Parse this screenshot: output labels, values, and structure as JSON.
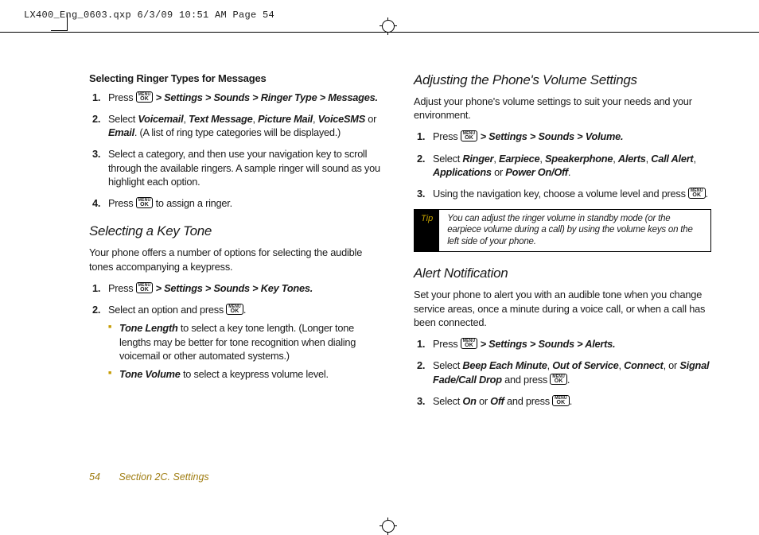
{
  "header_line": "LX400_Eng_0603.qxp  6/3/09  10:51 AM  Page 54",
  "ok_top": "MENU",
  "ok_bottom": "OK",
  "left": {
    "h3": "Selecting Ringer Types for Messages",
    "steps_msg": {
      "s1a": "Press ",
      "s1b": " > Settings > Sounds > Ringer Type > Messages.",
      "s2a": "Select ",
      "s2b": "Voicemail",
      "s2c": ", ",
      "s2d": "Text Message",
      "s2e": ", ",
      "s2f": "Picture Mail",
      "s2g": ", ",
      "s2h": "VoiceSMS",
      "s2i": " or ",
      "s2j": "Email",
      "s2k": ". (A list of ring type categories will be displayed.)",
      "s3": "Select a category, and then use your navigation key to scroll through the available ringers. A sample ringer will sound as you highlight each option.",
      "s4a": "Press ",
      "s4b": " to assign a ringer."
    },
    "h2": "Selecting a Key Tone",
    "intro": "Your phone offers a number of options for selecting the audible tones accompanying a keypress.",
    "steps_key": {
      "s1a": "Press ",
      "s1b": " > Settings > Sounds > Key Tones.",
      "s2a": "Select an option and press ",
      "s2b": ".",
      "sub1a": "Tone Length",
      "sub1b": " to select a key tone length. (Longer tone lengths may be better for tone recognition when dialing voicemail or other automated systems.)",
      "sub2a": "Tone Volume",
      "sub2b": " to select a keypress volume level."
    }
  },
  "right": {
    "h2a": "Adjusting the Phone's Volume Settings",
    "intro_a": "Adjust your phone's volume settings to suit your needs and your environment.",
    "steps_vol": {
      "s1a": "Press ",
      "s1b": " > Settings > Sounds > Volume.",
      "s2a": "Select ",
      "s2b": "Ringer",
      "s2c": ", ",
      "s2d": "Earpiece",
      "s2e": ", ",
      "s2f": "Speakerphone",
      "s2g": ", ",
      "s2h": "Alerts",
      "s2i": ", ",
      "s2j": "Call Alert",
      "s2k": ", ",
      "s2l": "Applications",
      "s2m": " or ",
      "s2n": "Power On/Off",
      "s2o": ".",
      "s3a": "Using the navigation key, choose a volume level and press ",
      "s3b": "."
    },
    "tip_label": "Tip",
    "tip_text": "You can adjust the ringer volume in standby mode (or the earpiece volume during a call) by using the volume keys on the left side of your phone.",
    "h2b": "Alert Notification",
    "intro_b": "Set your phone to alert you with an audible tone when you change service areas, once a minute during a voice call, or when a call has been connected.",
    "steps_alert": {
      "s1a": "Press ",
      "s1b": " > Settings > Sounds > Alerts.",
      "s2a": "Select ",
      "s2b": "Beep Each Minute",
      "s2c": ", ",
      "s2d": "Out of Service",
      "s2e": ", ",
      "s2f": "Connect",
      "s2g": ", or ",
      "s2h": "Signal Fade/Call Drop",
      "s2i": " and press ",
      "s2j": ".",
      "s3a": "Select ",
      "s3b": "On",
      "s3c": " or ",
      "s3d": "Off",
      "s3e": " and press ",
      "s3f": "."
    }
  },
  "footer": {
    "page": "54",
    "section": "Section 2C. Settings"
  }
}
